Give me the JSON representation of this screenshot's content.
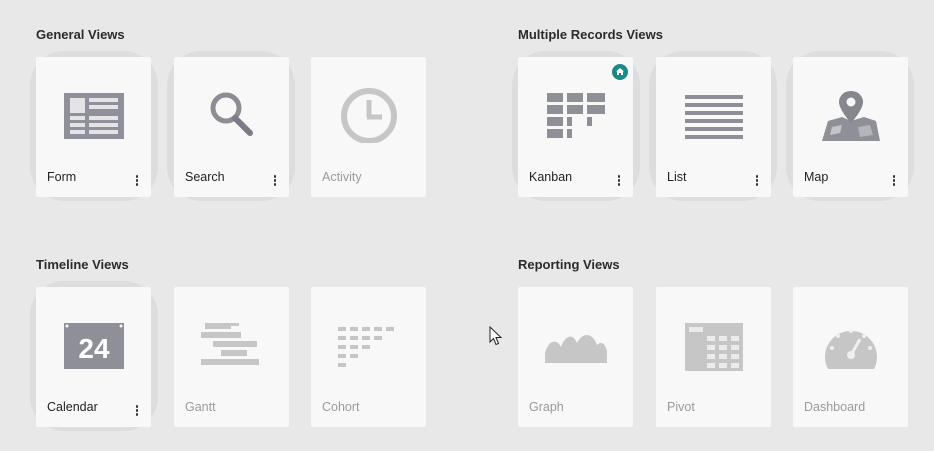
{
  "groups": {
    "general": {
      "title": "General Views",
      "cards": [
        {
          "label": "Form",
          "icon": "form-icon",
          "enabled": true
        },
        {
          "label": "Search",
          "icon": "search-icon",
          "enabled": true
        },
        {
          "label": "Activity",
          "icon": "clock-icon",
          "enabled": false
        }
      ]
    },
    "multiple": {
      "title": "Multiple Records Views",
      "cards": [
        {
          "label": "Kanban",
          "icon": "kanban-icon",
          "enabled": true,
          "default": true
        },
        {
          "label": "List",
          "icon": "list-icon",
          "enabled": true
        },
        {
          "label": "Map",
          "icon": "map-icon",
          "enabled": true
        }
      ]
    },
    "timeline": {
      "title": "Timeline Views",
      "cards": [
        {
          "label": "Calendar",
          "icon": "calendar-icon",
          "enabled": true,
          "day": "24"
        },
        {
          "label": "Gantt",
          "icon": "gantt-icon",
          "enabled": false
        },
        {
          "label": "Cohort",
          "icon": "cohort-icon",
          "enabled": false
        }
      ]
    },
    "reporting": {
      "title": "Reporting Views",
      "cards": [
        {
          "label": "Graph",
          "icon": "graph-icon",
          "enabled": false
        },
        {
          "label": "Pivot",
          "icon": "pivot-icon",
          "enabled": false
        },
        {
          "label": "Dashboard",
          "icon": "dashboard-icon",
          "enabled": false
        }
      ]
    }
  },
  "colors": {
    "background": "#e8e8e8",
    "card": "#f8f8f8",
    "active_halo": "#dddddd",
    "default_badge": "#1b8a86",
    "icon_gray": "#8a8a8a"
  }
}
